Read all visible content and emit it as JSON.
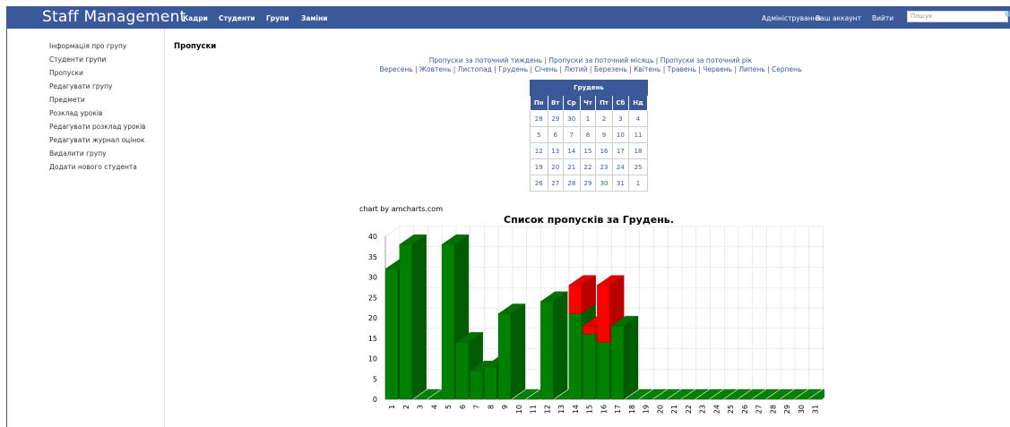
{
  "navbar": {
    "brand": "Staff Management",
    "links": [
      "Кадри",
      "Студенти",
      "Групи",
      "Заміни"
    ],
    "right_links": [
      "Адміністрування",
      "Ваш аккаунт",
      "Вийти"
    ],
    "search_placeholder": "Пошук",
    "color": "#3b5998"
  },
  "sidebar": {
    "items": [
      "Інформація про групу",
      "Студенти групи",
      "Пропуски",
      "Редагувати групу",
      "Предмети",
      "Розклад уроків",
      "Редагувати розклад уроків",
      "Редагувати журнал оцінок",
      "Видалити групу",
      "Додати нового студента"
    ]
  },
  "page": {
    "title": "Пропуски",
    "period_links": [
      "Пропуски за поточний тиждень",
      "Пропуски за поточний місяць",
      "Пропуски за поточний рік"
    ],
    "month_links": [
      "Вересень",
      "Жовтень",
      "Листопад",
      "Грудень",
      "Січень",
      "Лютий",
      "Березень",
      "Квітень",
      "Травень",
      "Червень",
      "Липень",
      "Серпень"
    ]
  },
  "calendar": {
    "month": "Грудень",
    "weekdays": [
      "Пн",
      "Вт",
      "Ср",
      "Чт",
      "Пт",
      "Сб",
      "Нд"
    ],
    "weeks": [
      [
        "28",
        "29",
        "30",
        "1",
        "2",
        "3",
        "4"
      ],
      [
        "5",
        "6",
        "7",
        "8",
        "9",
        "10",
        "11"
      ],
      [
        "12",
        "13",
        "14",
        "15",
        "16",
        "17",
        "18"
      ],
      [
        "19",
        "20",
        "21",
        "22",
        "23",
        "24",
        "25"
      ],
      [
        "26",
        "27",
        "28",
        "29",
        "30",
        "31",
        "1"
      ]
    ]
  },
  "chart_credit": "chart by amcharts.com",
  "chart_data": {
    "type": "bar",
    "stacked": true,
    "three_d": true,
    "title": "Список пропусків за Грудень.",
    "categories": [
      "1",
      "2",
      "3",
      "4",
      "5",
      "6",
      "7",
      "8",
      "9",
      "10",
      "11",
      "12",
      "13",
      "14",
      "15",
      "16",
      "17",
      "18",
      "19",
      "20",
      "21",
      "22",
      "23",
      "24",
      "25",
      "26",
      "27",
      "28",
      "29",
      "30",
      "31"
    ],
    "yticks": [
      0,
      5,
      10,
      15,
      20,
      25,
      30,
      35,
      40
    ],
    "ylim": [
      0,
      40
    ],
    "grid": true,
    "series": [
      {
        "color": "#008000",
        "values": [
          32,
          38,
          0,
          0,
          38,
          14,
          7,
          8,
          21,
          0,
          0,
          24,
          0,
          21,
          16,
          14,
          18,
          0,
          0,
          0,
          0,
          0,
          0,
          0,
          0,
          0,
          0,
          0,
          0,
          0,
          0
        ]
      },
      {
        "color": "#ff0000",
        "values": [
          0,
          0,
          0,
          0,
          0,
          0,
          0,
          0,
          0,
          0,
          0,
          0,
          0,
          7,
          2,
          14,
          0,
          0,
          0,
          0,
          0,
          0,
          0,
          0,
          0,
          0,
          0,
          0,
          0,
          0,
          0
        ]
      }
    ]
  }
}
